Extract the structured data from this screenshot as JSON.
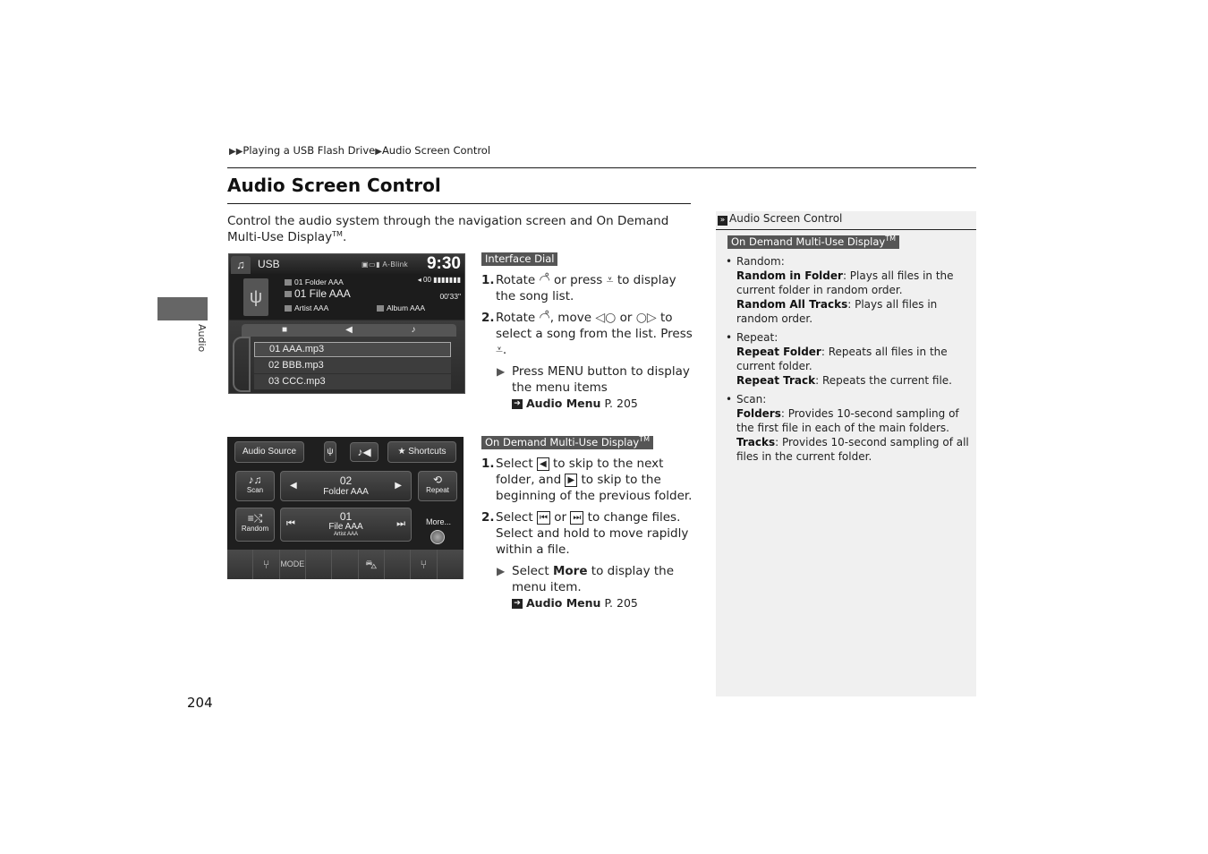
{
  "breadcrumb": {
    "separator": "▶",
    "items": [
      "Playing a USB Flash Drive",
      "Audio Screen Control"
    ]
  },
  "page": {
    "title": "Audio Screen Control",
    "intro": "Control the audio system through the navigation screen and On Demand Multi-Use Display",
    "intro_tm": "TM",
    "side_tab_label": "Audio",
    "page_number": "204"
  },
  "interface_dial": {
    "header": "Interface Dial",
    "steps": [
      {
        "num": "1.",
        "text_parts": [
          "Rotate",
          "or press",
          "to display the song list."
        ]
      },
      {
        "num": "2.",
        "text_parts": [
          "Rotate",
          ", move",
          "or",
          "to select a song from the list. Press",
          "."
        ]
      }
    ],
    "note": "Press MENU button to display the menu items",
    "ref": {
      "label": "Audio Menu",
      "page": "P. 205"
    }
  },
  "odmd": {
    "header": "On Demand Multi-Use Display",
    "header_tm": "TM",
    "steps": [
      {
        "num": "1.",
        "text_parts": [
          "Select",
          "to skip to the next folder, and",
          "to skip to the beginning of the previous folder."
        ]
      },
      {
        "num": "2.",
        "text_parts": [
          "Select",
          "or",
          "to change files. Select and hold to move rapidly within a file."
        ]
      }
    ],
    "note_parts": [
      "Select",
      "More",
      "to display the menu item."
    ],
    "ref": {
      "label": "Audio Menu",
      "page": "P. 205"
    }
  },
  "sidebar": {
    "header": "Audio Screen Control",
    "section": "On Demand Multi-Use Display",
    "section_tm": "TM",
    "items": [
      {
        "title": "Random",
        "entries": [
          {
            "term": "Random in Folder",
            "desc": ": Plays all files in the current folder in random order."
          },
          {
            "term": "Random All Tracks",
            "desc": ": Plays all files in random order."
          }
        ]
      },
      {
        "title": "Repeat",
        "entries": [
          {
            "term": "Repeat Folder",
            "desc": ": Repeats all files in the current folder."
          },
          {
            "term": "Repeat Track",
            "desc": ": Repeats the current file."
          }
        ]
      },
      {
        "title": "Scan",
        "entries": [
          {
            "term": "Folders",
            "desc": ": Provides 10-second sampling of the first file in each of the main folders."
          },
          {
            "term": "Tracks",
            "desc": ": Provides 10-second sampling of all files in the current folder."
          }
        ]
      }
    ]
  },
  "screen1": {
    "source": "USB",
    "status": "A-Blink",
    "clock": "9:30",
    "folder": "01 Folder AAA",
    "file": "01 File AAA",
    "artist": "Artist AAA",
    "album": "Album AAA",
    "volume": "00",
    "elapsed": "00'33\"",
    "songs": [
      "01 AAA.mp3",
      "02 BBB.mp3",
      "03 CCC.mp3"
    ]
  },
  "screen2": {
    "audio_source": "Audio Source",
    "shortcuts": "Shortcuts",
    "scan": "Scan",
    "repeat": "Repeat",
    "random": "Random",
    "folder_num": "02",
    "folder_name": "Folder AAA",
    "file_num": "01",
    "file_name": "File AAA",
    "artist": "Artist AAA",
    "more": "More...",
    "mode": "MODE"
  }
}
